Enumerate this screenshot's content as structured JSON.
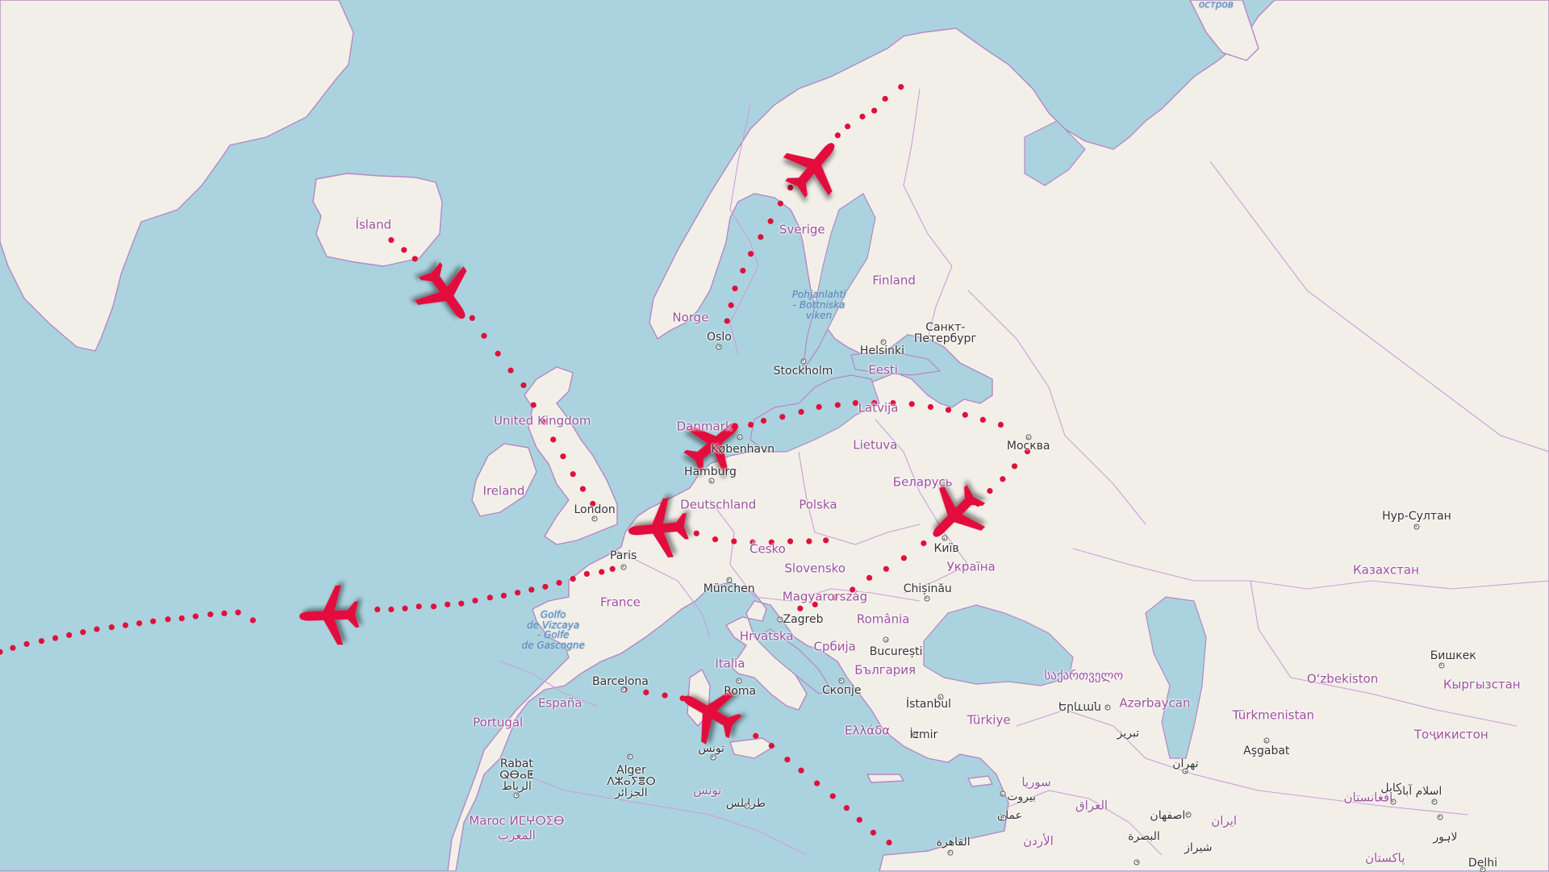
{
  "map": {
    "colors": {
      "water": "#aad3df",
      "land": "#f2efe9",
      "border": "#b787c4",
      "route": "#e0103a",
      "plane": "#e2103c"
    },
    "countries": [
      {
        "id": "island",
        "name": "Ísland"
      },
      {
        "id": "norge",
        "name": "Norge"
      },
      {
        "id": "sverige",
        "name": "Sverige"
      },
      {
        "id": "finland",
        "name": "Finland"
      },
      {
        "id": "eesti",
        "name": "Eesti"
      },
      {
        "id": "latvija",
        "name": "Latvija"
      },
      {
        "id": "lietuva",
        "name": "Lietuva"
      },
      {
        "id": "danmark",
        "name": "Danmark"
      },
      {
        "id": "uk",
        "name": "United Kingdom"
      },
      {
        "id": "ireland",
        "name": "Ireland"
      },
      {
        "id": "deutschland",
        "name": "Deutschland"
      },
      {
        "id": "polska",
        "name": "Polska"
      },
      {
        "id": "belarus",
        "name": "Беларусь"
      },
      {
        "id": "ukraine",
        "name": "Україна"
      },
      {
        "id": "cesko",
        "name": "Česko"
      },
      {
        "id": "slovensko",
        "name": "Slovensko"
      },
      {
        "id": "magyar",
        "name": "Magyarország"
      },
      {
        "id": "romania",
        "name": "România"
      },
      {
        "id": "france",
        "name": "France"
      },
      {
        "id": "hrvatska",
        "name": "Hrvatska"
      },
      {
        "id": "srbija",
        "name": "Србија"
      },
      {
        "id": "bulgaria",
        "name": "България"
      },
      {
        "id": "italia",
        "name": "Italia"
      },
      {
        "id": "espana",
        "name": "España"
      },
      {
        "id": "portugal",
        "name": "Portugal"
      },
      {
        "id": "ellada",
        "name": "Ελλάδα"
      },
      {
        "id": "turkiye",
        "name": "Türkiye"
      },
      {
        "id": "georgia",
        "name": "საქართველო"
      },
      {
        "id": "azerbaycan",
        "name": "Azərbaycan"
      },
      {
        "id": "kazakhstan",
        "name": "Казахстан"
      },
      {
        "id": "uzbekistan",
        "name": "O‘zbekiston"
      },
      {
        "id": "kyrgyzstan",
        "name": "Кыргызстан"
      },
      {
        "id": "turkmenistan",
        "name": "Türkmenistan"
      },
      {
        "id": "tajikistan",
        "name": "Тоҷикистон"
      },
      {
        "id": "afghanistan",
        "name": "افغانستان"
      },
      {
        "id": "pakistan",
        "name": "پاکستان"
      },
      {
        "id": "iran",
        "name": "ایران"
      },
      {
        "id": "iraq",
        "name": "العراق"
      },
      {
        "id": "syria",
        "name": "سوريا"
      },
      {
        "id": "jordan",
        "name": "الأردن"
      },
      {
        "id": "tunisia",
        "name": "تونس"
      },
      {
        "id": "maroc",
        "name": "Maroc ⵍⵎⵖⵔⵉⴱ"
      },
      {
        "id": "maroc_ar",
        "name": "المغرب"
      }
    ],
    "cities": [
      {
        "id": "oslo",
        "name": "Oslo"
      },
      {
        "id": "stockholm",
        "name": "Stockholm"
      },
      {
        "id": "helsinki",
        "name": "Helsinki"
      },
      {
        "id": "spb",
        "name": "Санкт-\nПетербург"
      },
      {
        "id": "moskva",
        "name": "Москва"
      },
      {
        "id": "kobenhavn",
        "name": "København"
      },
      {
        "id": "hamburg",
        "name": "Hamburg"
      },
      {
        "id": "london",
        "name": "London"
      },
      {
        "id": "paris",
        "name": "Paris"
      },
      {
        "id": "munchen",
        "name": "München"
      },
      {
        "id": "kyiv",
        "name": "Київ"
      },
      {
        "id": "chisinau",
        "name": "Chișinău"
      },
      {
        "id": "zagreb",
        "name": "Zagreb"
      },
      {
        "id": "bucuresti",
        "name": "București"
      },
      {
        "id": "skopje",
        "name": "Скопје"
      },
      {
        "id": "istanbul",
        "name": "İstanbul"
      },
      {
        "id": "izmir",
        "name": "İzmir"
      },
      {
        "id": "yerevan",
        "name": "Երևան"
      },
      {
        "id": "tabriz",
        "name": "تبریز"
      },
      {
        "id": "tehran",
        "name": "تهران"
      },
      {
        "id": "roma",
        "name": "Roma"
      },
      {
        "id": "barcelona",
        "name": "Barcelona"
      },
      {
        "id": "tunis",
        "name": "تونس"
      },
      {
        "id": "alger",
        "name": "Alger\nⴷⵣⴰⵢⴻⵔ\nالجزائر"
      },
      {
        "id": "rabat",
        "name": "Rabat\nⵕⴱⴰⵟ\nالرباط"
      },
      {
        "id": "tripoli",
        "name": "طرابلس"
      },
      {
        "id": "cairo",
        "name": "القاهرة"
      },
      {
        "id": "beirut",
        "name": "بيروت"
      },
      {
        "id": "amman",
        "name": "عمان"
      },
      {
        "id": "basra",
        "name": "البصرة"
      },
      {
        "id": "isfahan",
        "name": "اصفهان"
      },
      {
        "id": "shiraz",
        "name": "شيراز"
      },
      {
        "id": "astana",
        "name": "Нур-Султан"
      },
      {
        "id": "bishkek",
        "name": "Бишкек"
      },
      {
        "id": "ashgabat",
        "name": "Aşgabat"
      },
      {
        "id": "kabul",
        "name": "کابل"
      },
      {
        "id": "islamabad",
        "name": "اسلام آباد"
      },
      {
        "id": "lahore",
        "name": "لاہور"
      },
      {
        "id": "delhi",
        "name": "Delhi"
      }
    ],
    "water_labels": [
      {
        "id": "bothnia",
        "name": "Pohjanlahti\n- Bottniska\nviken"
      },
      {
        "id": "biscay",
        "name": "Golfo\nde Vizcaya\n- Golfe\nde Gascogne"
      },
      {
        "id": "ostrov",
        "name": "остров"
      }
    ],
    "flights": [
      {
        "id": "iceland-london",
        "heading_deg": 145
      },
      {
        "id": "lapland-oslo",
        "heading_deg": 40
      },
      {
        "id": "moscow-copenhagen",
        "heading_deg": 50
      },
      {
        "id": "czech-belgium",
        "heading_deg": 265
      },
      {
        "id": "atlantic-westbound",
        "heading_deg": 268
      },
      {
        "id": "moscow-kyiv-zagreb",
        "heading_deg": 225
      },
      {
        "id": "egypt-barcelona",
        "heading_deg": 300
      }
    ]
  }
}
